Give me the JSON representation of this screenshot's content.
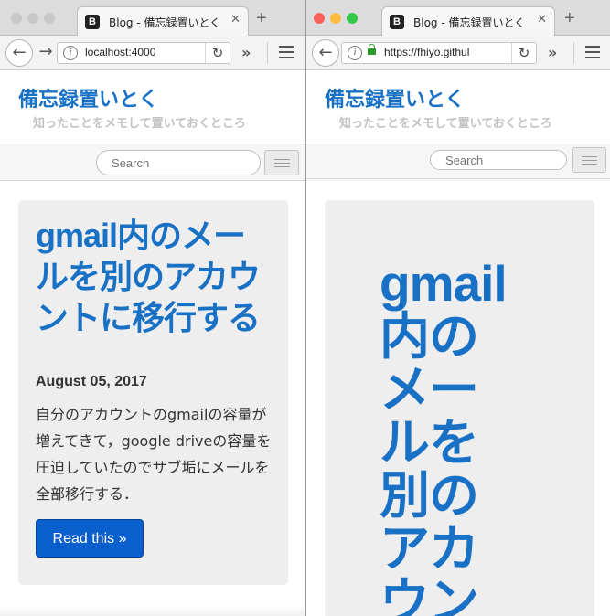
{
  "left_window": {
    "tab": {
      "favicon": "B",
      "title": "Blog - 備忘録置いとく",
      "close": "✕"
    },
    "new_tab": "+",
    "nav": {
      "back": "←",
      "forward": "→",
      "url": "localhost:4000",
      "reload": "↻",
      "overflow": "»"
    },
    "site": {
      "title": "備忘録置いとく",
      "tagline": "知ったことをメモして置いておくところ"
    },
    "search": {
      "placeholder": "Search"
    },
    "post": {
      "title": "gmail内のメールを別のアカウントに移行する",
      "date": "August 05, 2017",
      "excerpt": "自分のアカウントのgmailの容量が増えてきて，google driveの容量を圧迫していたのでサブ垢にメールを全部移行する．",
      "read_more": "Read this »"
    }
  },
  "right_window": {
    "tab": {
      "favicon": "B",
      "title": "Blog - 備忘録置いとく",
      "close": "✕"
    },
    "new_tab": "+",
    "nav": {
      "back": "←",
      "url": "https://fhiyo.githul",
      "reload": "↻",
      "overflow": "»"
    },
    "site": {
      "title": "備忘録置いとく",
      "tagline": "知ったことをメモして置いておくところ"
    },
    "search": {
      "placeholder": "Search"
    },
    "post": {
      "title_lines": [
        "gmail",
        "内の",
        "メー",
        "ルを",
        "別の",
        "アカ",
        "ウン"
      ]
    }
  },
  "colors": {
    "link_blue": "#1871c4",
    "button_blue": "#0a5fcf",
    "traffic_red": "#fc605b",
    "traffic_yellow": "#fdbc40",
    "traffic_green": "#34c84a",
    "traffic_inactive": "#c8c8c8"
  }
}
